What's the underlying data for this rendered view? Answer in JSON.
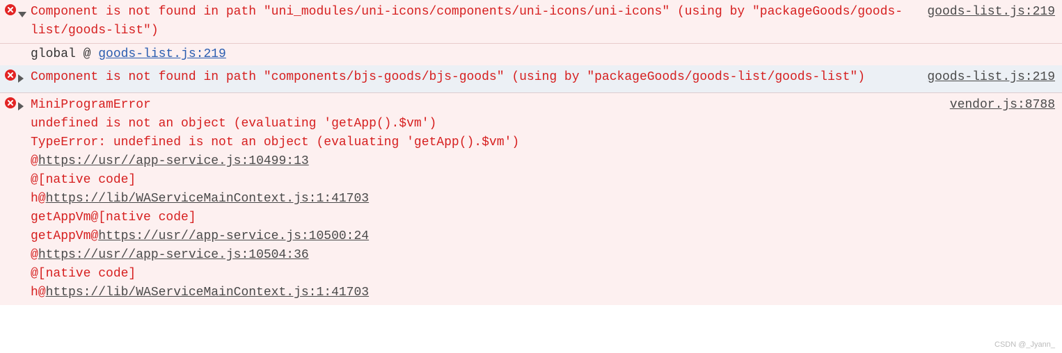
{
  "entries": [
    {
      "message": "Component is not found in path \"uni_modules/uni-icons/components/uni-icons/uni-icons\" (using by \"packageGoods/goods-list/goods-list\")",
      "source": "goods-list.js:219",
      "expanded": true,
      "trace": {
        "label": "global @ ",
        "link": "goods-list.js:219"
      }
    },
    {
      "message": "Component is not found in path \"components/bjs-goods/bjs-goods\" (using by \"packageGoods/goods-list/goods-list\")",
      "source": "goods-list.js:219",
      "expanded": false
    },
    {
      "title": "MiniProgramError",
      "source": "vendor.js:8788",
      "expanded": false,
      "lines": [
        {
          "text": "undefined is not an object (evaluating 'getApp().$vm')"
        },
        {
          "text": "TypeError: undefined is not an object (evaluating 'getApp().$vm')"
        },
        {
          "prefix": "@",
          "link": "https://usr//app-service.js:10499:13"
        },
        {
          "text": "@[native code]"
        },
        {
          "prefix": "h@",
          "link": "https://lib/WAServiceMainContext.js:1:41703"
        },
        {
          "text": "getAppVm@[native code]"
        },
        {
          "prefix": "getAppVm@",
          "link": "https://usr//app-service.js:10500:24"
        },
        {
          "prefix": "@",
          "link": "https://usr//app-service.js:10504:36"
        },
        {
          "text": "@[native code]"
        },
        {
          "prefix": "h@",
          "link": "https://lib/WAServiceMainContext.js:1:41703"
        }
      ]
    }
  ],
  "watermark": "CSDN @_Jyann_"
}
